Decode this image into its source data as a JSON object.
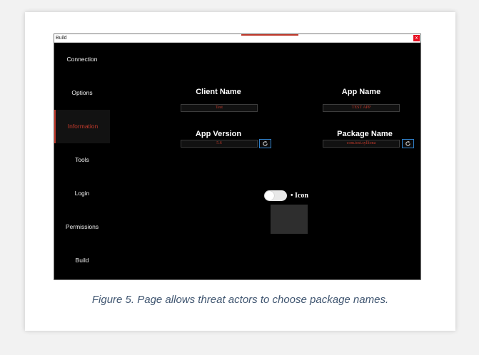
{
  "window": {
    "title": "Build",
    "close_symbol": "x"
  },
  "sidebar": {
    "items": [
      {
        "label": "Connection",
        "active": false
      },
      {
        "label": "Options",
        "active": false
      },
      {
        "label": "Information",
        "active": true
      },
      {
        "label": "Tools",
        "active": false
      },
      {
        "label": "Login",
        "active": false
      },
      {
        "label": "Permissions",
        "active": false
      },
      {
        "label": "Build",
        "active": false
      }
    ]
  },
  "form": {
    "client_name": {
      "label": "Client Name",
      "value": "Test"
    },
    "app_name": {
      "label": "App Name",
      "value": "TEST APP"
    },
    "app_version": {
      "label": "App Version",
      "value": "5.6"
    },
    "package_name": {
      "label": "Package Name",
      "value": "com.test.sylliona"
    },
    "icon_toggle": {
      "label": "• Icon",
      "on": false
    }
  },
  "caption": "Figure 5. Page allows threat actors to choose package names.",
  "colors": {
    "accent": "#c0392b",
    "button_border": "#2e7fc9",
    "caption": "#3f5570"
  },
  "icons": {
    "refresh": "refresh-icon",
    "close": "close-icon"
  }
}
